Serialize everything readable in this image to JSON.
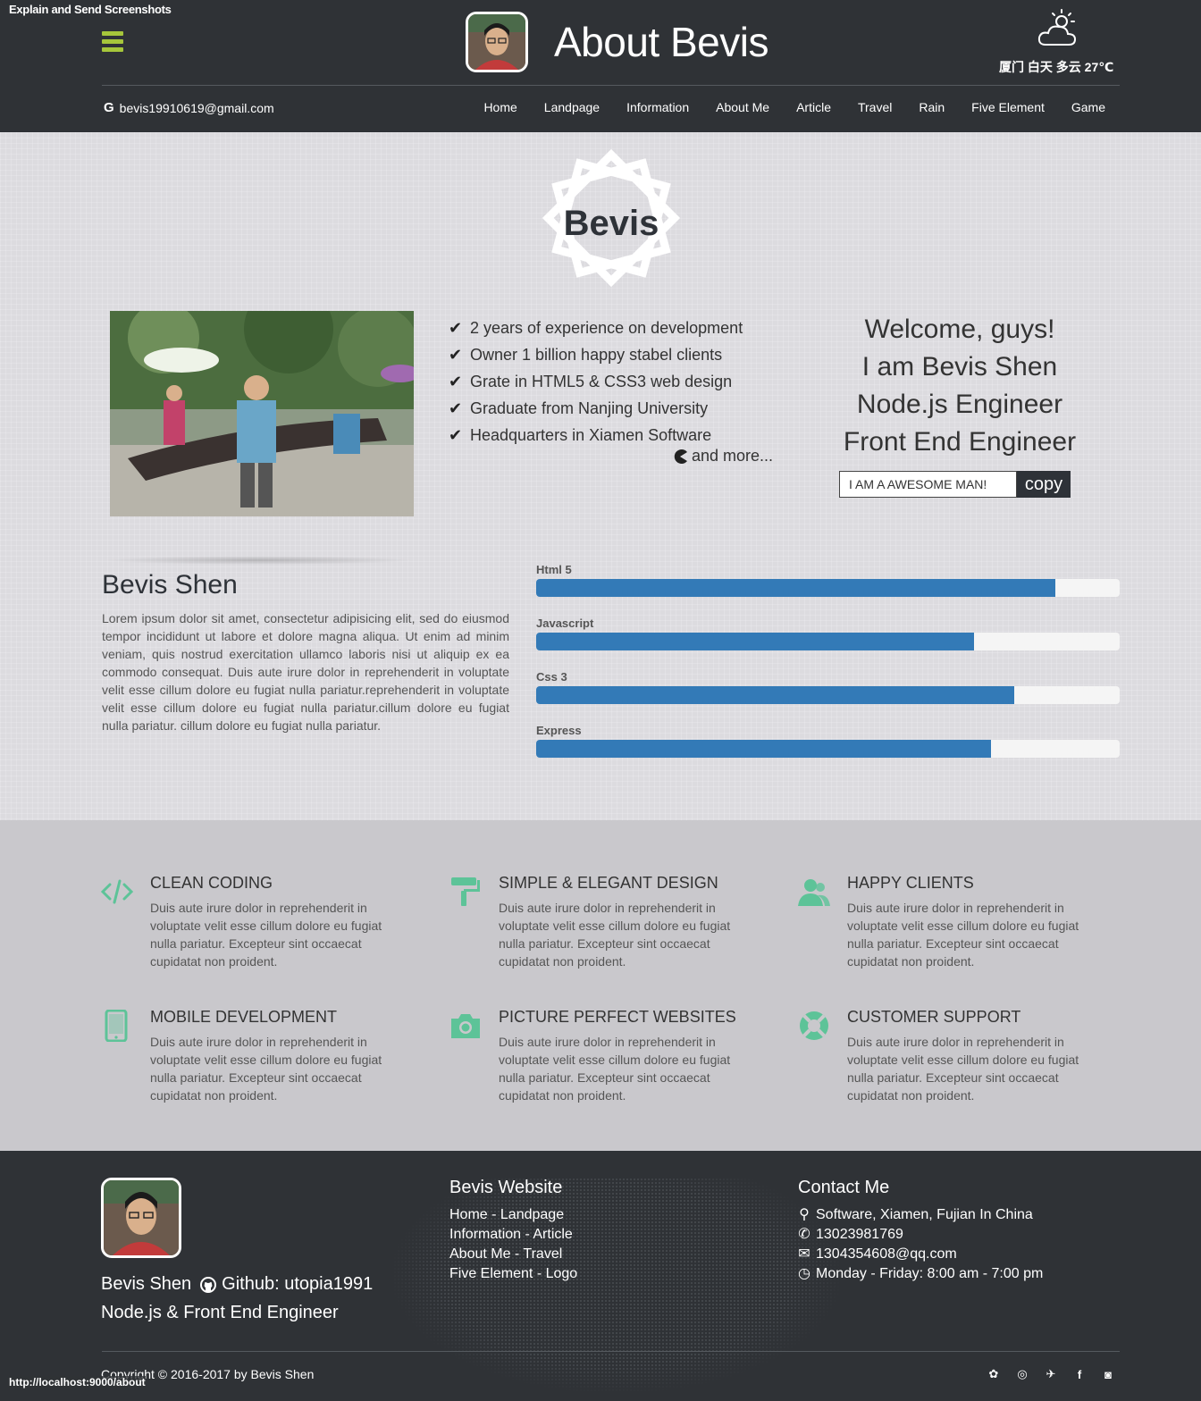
{
  "browser": {
    "extension_label": "Explain and Send Screenshots",
    "status_url": "http://localhost:9000/about"
  },
  "header": {
    "title": "About Bevis",
    "email": "bevis19910619@gmail.com",
    "email_icon": "google-icon",
    "weather": "厦门 白天 多云 27℃",
    "weather_icon": "partly-cloudy-icon",
    "accent_color": "#a6c63b",
    "nav": [
      "Home",
      "Landpage",
      "Information",
      "About Me",
      "Article",
      "Travel",
      "Rain",
      "Five Element",
      "Game"
    ]
  },
  "hero": {
    "logo_text": "Bevis",
    "checklist": [
      "2 years of experience on development",
      "Owner 1 billion happy stabel clients",
      "Grate in HTML5 & CSS3 web design",
      "Graduate from Nanjing University",
      "Headquarters in Xiamen Software"
    ],
    "more": "and more...",
    "welcome_lines": [
      "Welcome, guys!",
      "I am Bevis Shen",
      "Node.js Engineer",
      "Front End Engineer"
    ],
    "copy_input_value": "I AM A AWESOME MAN!",
    "copy_button": "copy"
  },
  "bio": {
    "name": "Bevis Shen",
    "text": "Lorem ipsum dolor sit amet, consectetur adipisicing elit, sed do eiusmod tempor incididunt ut labore et dolore magna aliqua. Ut enim ad minim veniam, quis nostrud exercitation ullamco laboris nisi ut aliquip ex ea commodo consequat. Duis aute irure dolor in reprehenderit in voluptate velit esse cillum dolore eu fugiat nulla pariatur.reprehenderit in voluptate velit esse cillum dolore eu fugiat nulla pariatur.cillum dolore eu fugiat nulla pariatur. cillum dolore eu fugiat nulla pariatur."
  },
  "skills": [
    {
      "name": "Html 5",
      "percent": 89
    },
    {
      "name": "Javascript",
      "percent": 75
    },
    {
      "name": "Css 3",
      "percent": 82
    },
    {
      "name": "Express",
      "percent": 78
    }
  ],
  "skill_color": "#337ab7",
  "features": {
    "icon_color": "#5dc398",
    "items": [
      {
        "title": "CLEAN CODING",
        "icon": "code-icon",
        "text": "Duis aute irure dolor in reprehenderit in voluptate velit esse cillum dolore eu fugiat nulla pariatur. Excepteur sint occaecat cupidatat non proident."
      },
      {
        "title": "SIMPLE & ELEGANT DESIGN",
        "icon": "paint-roller-icon",
        "text": "Duis aute irure dolor in reprehenderit in voluptate velit esse cillum dolore eu fugiat nulla pariatur. Excepteur sint occaecat cupidatat non proident."
      },
      {
        "title": "HAPPY CLIENTS",
        "icon": "users-icon",
        "text": "Duis aute irure dolor in reprehenderit in voluptate velit esse cillum dolore eu fugiat nulla pariatur. Excepteur sint occaecat cupidatat non proident."
      },
      {
        "title": "MOBILE DEVELOPMENT",
        "icon": "mobile-icon",
        "text": "Duis aute irure dolor in reprehenderit in voluptate velit esse cillum dolore eu fugiat nulla pariatur. Excepteur sint occaecat cupidatat non proident."
      },
      {
        "title": "PICTURE PERFECT WEBSITES",
        "icon": "camera-icon",
        "text": "Duis aute irure dolor in reprehenderit in voluptate velit esse cillum dolore eu fugiat nulla pariatur. Excepteur sint occaecat cupidatat non proident."
      },
      {
        "title": "CUSTOMER SUPPORT",
        "icon": "lifebuoy-icon",
        "text": "Duis aute irure dolor in reprehenderit in voluptate velit esse cillum dolore eu fugiat nulla pariatur. Excepteur sint occaecat cupidatat non proident."
      }
    ]
  },
  "footer": {
    "name": "Bevis Shen",
    "github": "Github: utopia1991",
    "role": "Node.js & Front End Engineer",
    "website_title": "Bevis Website",
    "website_links": [
      "Home - Landpage",
      "Information - Article",
      "About Me - Travel",
      "Five Element - Logo"
    ],
    "contact_title": "Contact Me",
    "contacts": [
      {
        "icon": "map-marker-icon",
        "text": "Software, Xiamen, Fujian In China"
      },
      {
        "icon": "phone-icon",
        "text": "13023981769"
      },
      {
        "icon": "envelope-icon",
        "text": "1304354608@qq.com"
      },
      {
        "icon": "clock-icon",
        "text": "Monday - Friday: 8:00 am - 7:00 pm"
      }
    ],
    "copyright": "Copyright © 2016-2017 by Bevis Shen",
    "socials": [
      "wechat-icon",
      "weibo-icon",
      "twitter-icon",
      "facebook-icon",
      "instagram-icon"
    ]
  }
}
